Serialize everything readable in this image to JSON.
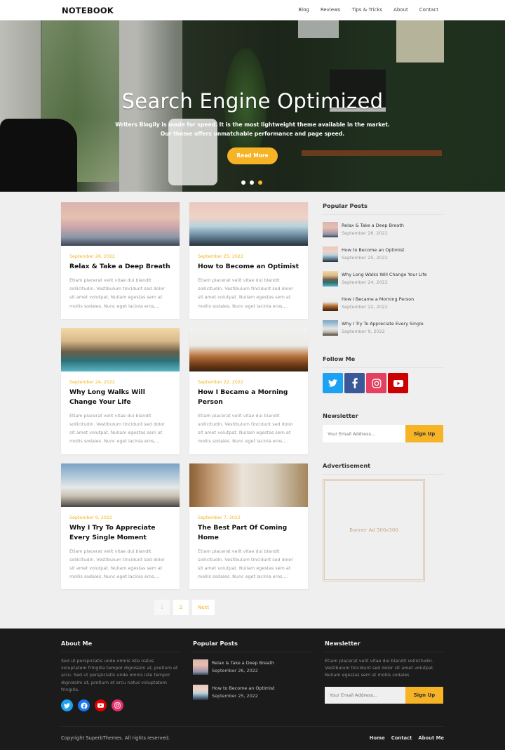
{
  "header": {
    "logo": "NOTEBOOK",
    "nav": [
      "Blog",
      "Reviews",
      "Tips & Tricks",
      "About",
      "Contact"
    ]
  },
  "hero": {
    "title": "Search Engine Optimized",
    "subtitle_line1": "Writers Blogily is made for speed. It is the most lightweight theme available in the market.",
    "subtitle_line2": "Our theme offers unmatchable performance and page speed.",
    "button": "Read More",
    "slides": 3,
    "active_slide": 3,
    "accent": "#f5b325"
  },
  "posts": [
    {
      "date": "September 26, 2022",
      "title": "Relax & Take a Deep Breath",
      "excerpt": "Etiam placerat velit vitae dui blandit sollicitudin. Vestibulum tincidunt sed dolor sit amet volutpat. Nullam egestas sem at mollis sodales. Nunc eget lacinia eros,...",
      "image": "sea-wave-sunset"
    },
    {
      "date": "September 25, 2022",
      "title": "How to Become an Optimist",
      "excerpt": "Etiam placerat velit vitae dui blandit sollicitudin. Vestibulum tincidunt sed dolor sit amet volutpat. Nullam egestas sem at mollis sodales. Nunc eget lacinia eros,...",
      "image": "snowy-mountain"
    },
    {
      "date": "September 24, 2022",
      "title": "Why Long Walks Will Change Your Life",
      "excerpt": "Etiam placerat velit vitae dui blandit sollicitudin. Vestibulum tincidunt sed dolor sit amet volutpat. Nullam egestas sem at mollis sodales. Nunc eget lacinia eros,...",
      "image": "coastal-cliff"
    },
    {
      "date": "September 22, 2022",
      "title": "How I Became a Morning Person",
      "excerpt": "Etiam placerat velit vitae dui blandit sollicitudin. Vestibulum tincidunt sed dolor sit amet volutpat. Nullam egestas sem at mollis sodales. Nunc eget lacinia eros,...",
      "image": "autumn-trees-birds"
    },
    {
      "date": "September 9, 2022",
      "title": "Why I Try To Appreciate Every Single Moment",
      "excerpt": "Etiam placerat velit vitae dui blandit sollicitudin. Vestibulum tincidunt sed dolor sit amet volutpat. Nullam egestas sem at mollis sodales. Nunc eget lacinia eros,...",
      "image": "rocky-beach"
    },
    {
      "date": "September 7, 2022",
      "title": "The Best Part Of Coming Home",
      "excerpt": "Etiam placerat velit vitae dui blandit sollicitudin. Vestibulum tincidunt sed dolor sit amet volutpat. Nullam egestas sem at mollis sodales. Nunc eget lacinia eros,...",
      "image": "cozy-bedroom"
    }
  ],
  "pagination": {
    "pages": [
      "1",
      "2"
    ],
    "current": "1",
    "next": "Next"
  },
  "sidebar": {
    "popular_title": "Popular Posts",
    "popular": [
      {
        "title": "Relax & Take a Deep Breath",
        "date": "September 26, 2022"
      },
      {
        "title": "How to Become an Optimist",
        "date": "September 25, 2022"
      },
      {
        "title": "Why Long Walks Will Change Your Life",
        "date": "September 24, 2022"
      },
      {
        "title": "How I Became a Morning Person",
        "date": "September 22, 2022"
      },
      {
        "title": "Why I Try To Appreciate Every Single",
        "date": "September 9, 2022"
      }
    ],
    "follow_title": "Follow Me",
    "social": [
      {
        "name": "twitter",
        "color": "#1da1f2"
      },
      {
        "name": "facebook",
        "color": "#3b5998"
      },
      {
        "name": "instagram",
        "color": "#e4405f"
      },
      {
        "name": "youtube",
        "color": "#cd0000"
      }
    ],
    "newsletter_title": "Newsletter",
    "newsletter_placeholder": "Your Email Address...",
    "newsletter_button": "Sign Up",
    "ad_title": "Advertisement",
    "ad_text": "Banner Ad 300x300"
  },
  "footer": {
    "about_title": "About Me",
    "about_text": "Sed ut perspiciatis unde omnis iste natus voluptatem fringilla tempor dignissim at, pretium et arcu. Sed ut perspiciatis unde omnis iste tempor dignissim at, pretium et arcu natus voluptatem fringilla.",
    "social": [
      {
        "name": "twitter",
        "color": "#1da1f2"
      },
      {
        "name": "facebook",
        "color": "#1877f2"
      },
      {
        "name": "youtube",
        "color": "#e00000"
      },
      {
        "name": "instagram",
        "color": "#e1306c"
      }
    ],
    "popular_title": "Popular Posts",
    "popular": [
      {
        "title": "Relax & Take a Deep Breath",
        "date": "September 26, 2022"
      },
      {
        "title": "How to Become an Optimist",
        "date": "September 25, 2022"
      }
    ],
    "newsletter_title": "Newsletter",
    "newsletter_text": "Etiam placerat velit vitae dui blandit sollicitudin. Vestibulum tincidunt sed dolor sit amet volutpat. Nullam egestas sem at mollis sodales",
    "newsletter_placeholder": "Your Email Address...",
    "newsletter_button": "Sign Up",
    "copyright": "Copyright SuperbThemes. All rights reserved.",
    "links": [
      "Home",
      "Contact",
      "About Me"
    ]
  }
}
